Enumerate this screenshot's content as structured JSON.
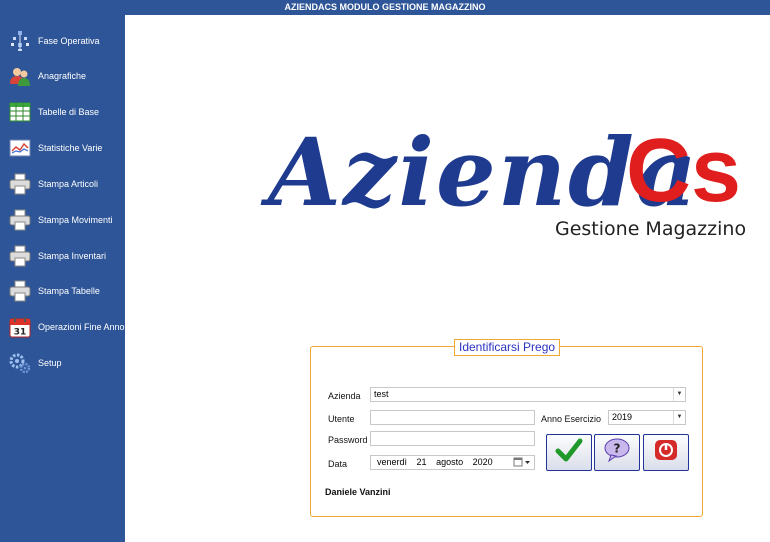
{
  "window": {
    "title": "AZIENDACS MODULO GESTIONE MAGAZZINO"
  },
  "sidebar": {
    "items": [
      {
        "label": "Fase Operativa",
        "icon": "network-icon"
      },
      {
        "label": "Anagrafiche",
        "icon": "users-icon"
      },
      {
        "label": "Tabelle di Base",
        "icon": "table-icon"
      },
      {
        "label": "Statistiche Varie",
        "icon": "chart-icon"
      },
      {
        "label": "Stampa Articoli",
        "icon": "printer-icon"
      },
      {
        "label": "Stampa Movimenti",
        "icon": "printer-icon"
      },
      {
        "label": "Stampa Inventari",
        "icon": "printer-icon"
      },
      {
        "label": "Stampa Tabelle",
        "icon": "printer-icon"
      },
      {
        "label": "Operazioni Fine Anno",
        "icon": "calendar-icon"
      },
      {
        "label": "Setup",
        "icon": "gears-icon"
      }
    ]
  },
  "logo": {
    "main": "Azienda",
    "accent": "Cs",
    "subtitle": "Gestione Magazzino"
  },
  "login": {
    "legend": "Identificarsi Prego",
    "azienda_label": "Azienda",
    "azienda_value": "test",
    "utente_label": "Utente",
    "utente_value": "",
    "anno_label": "Anno Esercizio",
    "anno_value": "2019",
    "password_label": "Password",
    "password_value": "",
    "data_label": "Data",
    "data_day": "venerdì",
    "data_num": "21",
    "data_month": "agosto",
    "data_year": "2020",
    "user_name": "Daniele Vanzini"
  },
  "colors": {
    "sidebar": "#2e5597",
    "logo_blue": "#1f3b8f",
    "logo_red": "#e01e1e",
    "accent_orange": "#f0a830",
    "legend_text": "#2a32c0"
  }
}
